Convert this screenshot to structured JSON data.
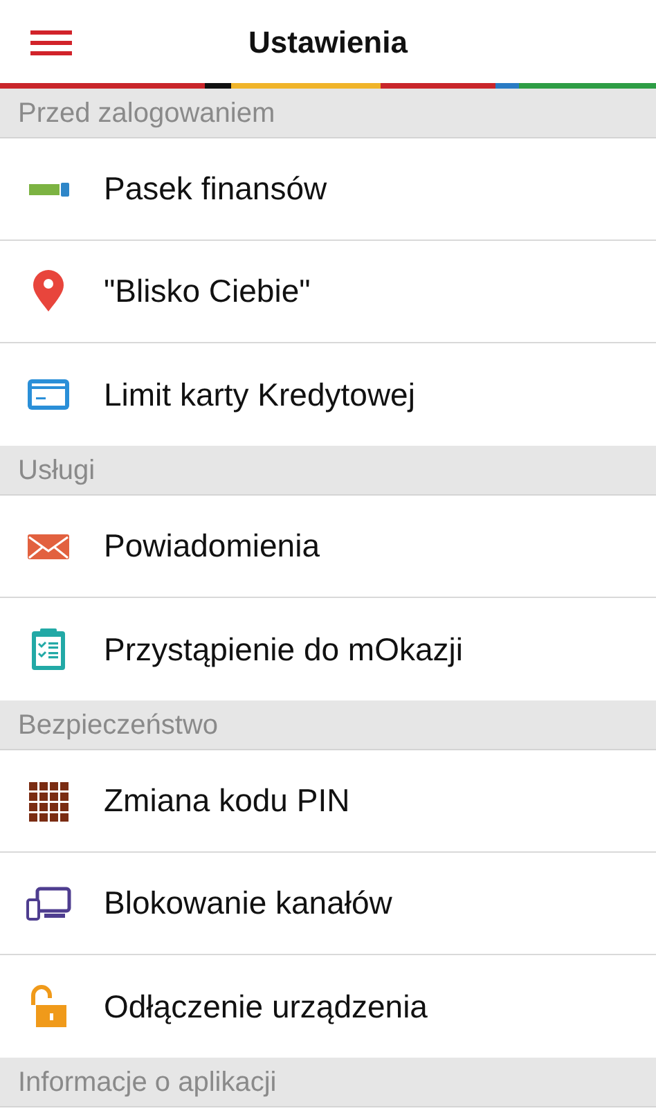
{
  "header": {
    "title": "Ustawienia"
  },
  "sections": [
    {
      "title": "Przed zalogowaniem",
      "items": [
        {
          "label": "Pasek finansów"
        },
        {
          "label": "\"Blisko Ciebie\""
        },
        {
          "label": "Limit karty Kredytowej"
        }
      ]
    },
    {
      "title": "Usługi",
      "items": [
        {
          "label": "Powiadomienia"
        },
        {
          "label": "Przystąpienie do mOkazji"
        }
      ]
    },
    {
      "title": "Bezpieczeństwo",
      "items": [
        {
          "label": "Zmiana kodu PIN"
        },
        {
          "label": "Blokowanie kanałów"
        },
        {
          "label": "Odłączenie urządzenia"
        }
      ]
    },
    {
      "title": "Informacje o aplikacji"
    }
  ]
}
